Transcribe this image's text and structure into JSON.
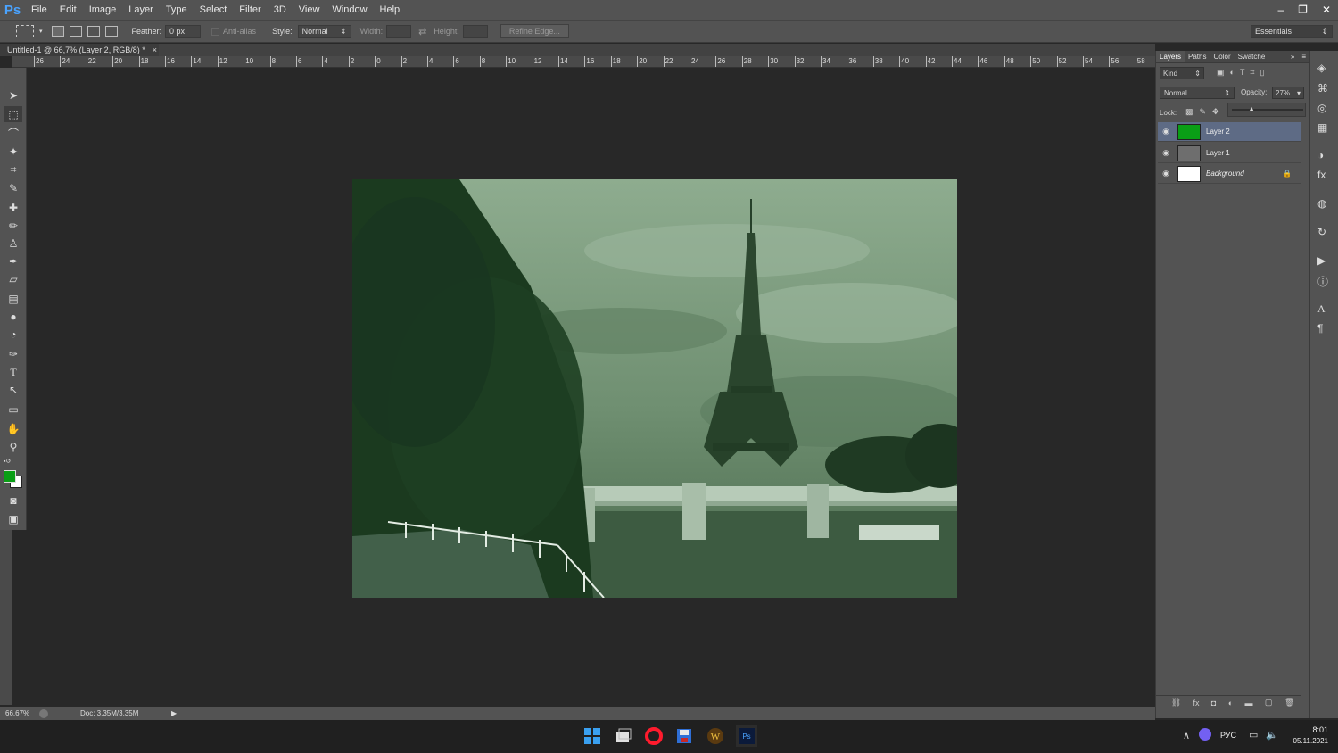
{
  "app": {
    "logo": "Ps",
    "menus": [
      "File",
      "Edit",
      "Image",
      "Layer",
      "Type",
      "Select",
      "Filter",
      "3D",
      "View",
      "Window",
      "Help"
    ],
    "window_controls": [
      "–",
      "❐",
      "✕"
    ]
  },
  "options": {
    "feather_label": "Feather:",
    "feather_value": "0 px",
    "antialias_label": "Anti-alias",
    "style_label": "Style:",
    "style_value": "Normal",
    "width_label": "Width:",
    "height_label": "Height:",
    "refine_edge": "Refine Edge...",
    "workspace": "Essentials"
  },
  "document": {
    "tab_title": "Untitled-1 @ 66,7% (Layer 2, RGB/8) *",
    "tab_close": "×",
    "ruler_labels": [
      "26",
      "24",
      "22",
      "20",
      "18",
      "16",
      "14",
      "12",
      "10",
      "8",
      "6",
      "4",
      "2",
      "0",
      "2",
      "4",
      "6",
      "8",
      "10",
      "12",
      "14",
      "16",
      "18",
      "20",
      "22",
      "24",
      "26",
      "28",
      "30",
      "32",
      "34",
      "36",
      "38",
      "40",
      "42",
      "44",
      "46",
      "48",
      "50",
      "52",
      "54",
      "56",
      "58",
      "60"
    ]
  },
  "status": {
    "zoom": "66,67%",
    "doc_size": "Doc: 3,35M/3,35M"
  },
  "layers_panel": {
    "tabs": [
      "Layers",
      "Paths",
      "Color",
      "Swatche"
    ],
    "active_tab": "Layers",
    "kind_label": "Kind",
    "blend_mode": "Normal",
    "opacity_label": "Opacity:",
    "opacity_value": "27%",
    "opacity_fraction": 0.27,
    "lock_label": "Lock:",
    "layers": [
      {
        "name": "Layer 2",
        "selected": true,
        "thumb_color": "#0a9e16"
      },
      {
        "name": "Layer 1",
        "selected": false,
        "thumb_color": "#6e6e6e"
      },
      {
        "name": "Background",
        "selected": false,
        "thumb_color": "#ffffff",
        "locked": true
      }
    ]
  },
  "taskbar": {
    "language": "РУС",
    "time": "8:01",
    "date": "05.11.2021"
  },
  "colors": {
    "foreground": "#0a9e16",
    "background": "#ffffff",
    "image_tint": "#7f9d80"
  }
}
